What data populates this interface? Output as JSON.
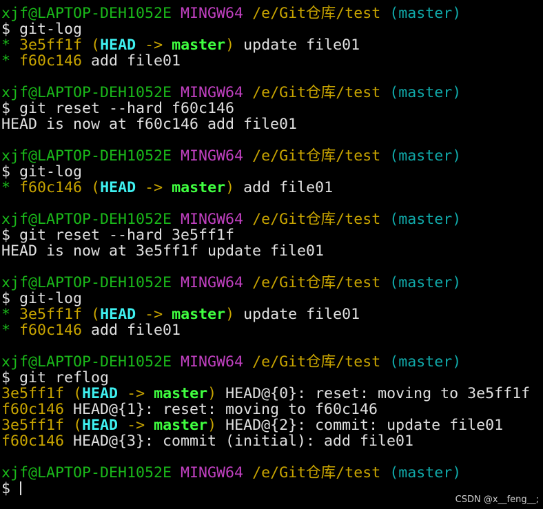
{
  "terminal": {
    "prompt": {
      "user_host": "xjf@LAPTOP-DEH1052E",
      "system": "MINGW64",
      "path": "/e/Git仓库/test",
      "branch": "(master)",
      "dollar": "$ "
    },
    "blocks": [
      {
        "command": "git-log",
        "output": [
          [
            {
              "text": "* ",
              "c": "green"
            },
            {
              "text": "3e5ff1f",
              "c": "yellow"
            },
            {
              "text": " ",
              "c": "default"
            },
            {
              "text": "(",
              "c": "yellow"
            },
            {
              "text": "HEAD",
              "c": "bcyan"
            },
            {
              "text": " -> ",
              "c": "yellow"
            },
            {
              "text": "master",
              "c": "bgreen"
            },
            {
              "text": ")",
              "c": "yellow"
            },
            {
              "text": " update file01",
              "c": "default"
            }
          ],
          [
            {
              "text": "* ",
              "c": "green"
            },
            {
              "text": "f60c146",
              "c": "yellow"
            },
            {
              "text": " add file01",
              "c": "default"
            }
          ]
        ]
      },
      {
        "command": "git reset --hard f60c146",
        "output": [
          [
            {
              "text": "HEAD is now at f60c146 add file01",
              "c": "default"
            }
          ]
        ]
      },
      {
        "command": "git-log",
        "output": [
          [
            {
              "text": "* ",
              "c": "green"
            },
            {
              "text": "f60c146",
              "c": "yellow"
            },
            {
              "text": " ",
              "c": "default"
            },
            {
              "text": "(",
              "c": "yellow"
            },
            {
              "text": "HEAD",
              "c": "bcyan"
            },
            {
              "text": " -> ",
              "c": "yellow"
            },
            {
              "text": "master",
              "c": "bgreen"
            },
            {
              "text": ")",
              "c": "yellow"
            },
            {
              "text": " add file01",
              "c": "default"
            }
          ]
        ]
      },
      {
        "command": "git reset --hard 3e5ff1f",
        "output": [
          [
            {
              "text": "HEAD is now at 3e5ff1f update file01",
              "c": "default"
            }
          ]
        ]
      },
      {
        "command": "git-log",
        "output": [
          [
            {
              "text": "* ",
              "c": "green"
            },
            {
              "text": "3e5ff1f",
              "c": "yellow"
            },
            {
              "text": " ",
              "c": "default"
            },
            {
              "text": "(",
              "c": "yellow"
            },
            {
              "text": "HEAD",
              "c": "bcyan"
            },
            {
              "text": " -> ",
              "c": "yellow"
            },
            {
              "text": "master",
              "c": "bgreen"
            },
            {
              "text": ")",
              "c": "yellow"
            },
            {
              "text": " update file01",
              "c": "default"
            }
          ],
          [
            {
              "text": "* ",
              "c": "green"
            },
            {
              "text": "f60c146",
              "c": "yellow"
            },
            {
              "text": " add file01",
              "c": "default"
            }
          ]
        ]
      },
      {
        "command": "git reflog",
        "output": [
          [
            {
              "text": "3e5ff1f",
              "c": "yellow"
            },
            {
              "text": " ",
              "c": "default"
            },
            {
              "text": "(",
              "c": "yellow"
            },
            {
              "text": "HEAD",
              "c": "bcyan"
            },
            {
              "text": " -> ",
              "c": "yellow"
            },
            {
              "text": "master",
              "c": "bgreen"
            },
            {
              "text": ")",
              "c": "yellow"
            },
            {
              "text": " HEAD@{0}: reset: moving to 3e5ff1f",
              "c": "default"
            }
          ],
          [
            {
              "text": "f60c146",
              "c": "yellow"
            },
            {
              "text": " HEAD@{1}: reset: moving to f60c146",
              "c": "default"
            }
          ],
          [
            {
              "text": "3e5ff1f",
              "c": "yellow"
            },
            {
              "text": " ",
              "c": "default"
            },
            {
              "text": "(",
              "c": "yellow"
            },
            {
              "text": "HEAD",
              "c": "bcyan"
            },
            {
              "text": " -> ",
              "c": "yellow"
            },
            {
              "text": "master",
              "c": "bgreen"
            },
            {
              "text": ")",
              "c": "yellow"
            },
            {
              "text": " HEAD@{2}: commit: update file01",
              "c": "default"
            }
          ],
          [
            {
              "text": "f60c146",
              "c": "yellow"
            },
            {
              "text": " HEAD@{3}: commit (initial): add file01",
              "c": "default"
            }
          ]
        ]
      }
    ],
    "final_prompt": true
  },
  "watermark": "CSDN @x__feng__;",
  "colors": {
    "background": "#000000",
    "default": "#e0e0e0",
    "green": "#1ab81a",
    "purple": "#c040c0",
    "yellow": "#c8a400",
    "cyan": "#10a8a8",
    "bold_cyan": "#3ff0f0",
    "bold_green": "#40ff40"
  }
}
